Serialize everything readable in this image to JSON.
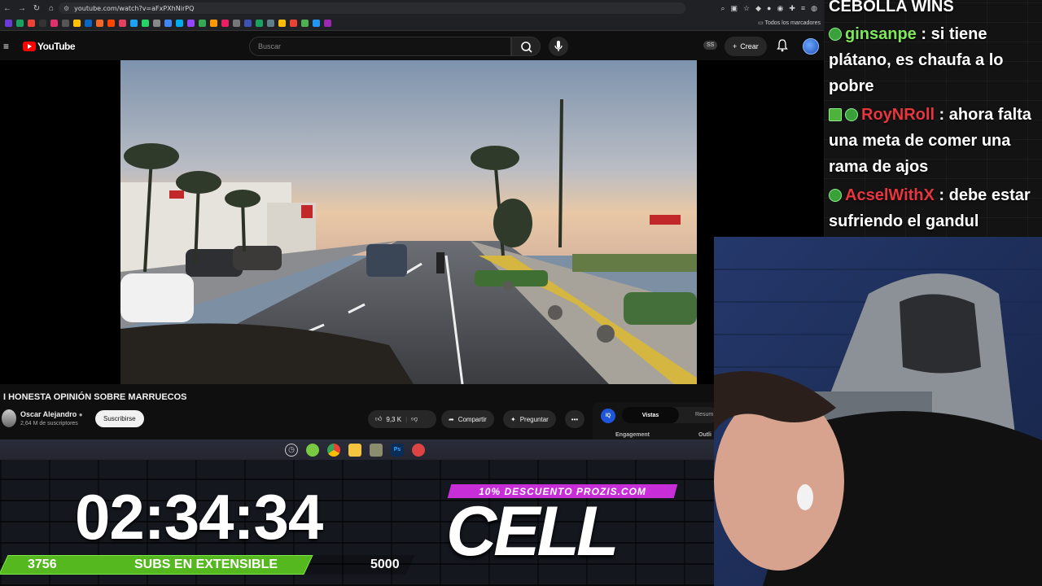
{
  "browser": {
    "url": "youtube.com/watch?v=aFxPXhNirPQ",
    "bookmarks_folder_label": "Todos los marcadores"
  },
  "youtube": {
    "logo_text": "YouTube",
    "search_placeholder": "Buscar",
    "header_badge": "SS",
    "create_label": "Crear",
    "video_title": "I HONESTA OPINIÓN SOBRE MARRUECOS",
    "channel_name": "Oscar Alejandro",
    "channel_subscribers": "2,64 M de suscriptores",
    "subscribe_label": "Suscribirse",
    "likes": "9,3 K",
    "share_label": "Compartir",
    "ask_label": "Preguntar",
    "side_panel": {
      "iq_label": "IQ",
      "tab_active": "Vistas",
      "tab_2": "Resum",
      "metric_1": "Engagement",
      "metric_2": "Outli"
    }
  },
  "stream_overlay": {
    "timer": "02:34:34",
    "subgoal_current": "3756",
    "subgoal_label": "SUBS EN EXTENSIBLE",
    "subgoal_target": "5000",
    "subgoal_progress": 0.75,
    "promo_text": "10% DESCUENTO PROZIS.COM",
    "brand_logo": "CELL"
  },
  "chat": {
    "messages": [
      {
        "user": "",
        "text": "CEBOLLA WINS"
      },
      {
        "user": "ginsanpe",
        "text": "si tiene plátano, es chaufa a lo pobre"
      },
      {
        "user": "RoyNRoll",
        "text": "ahora falta una meta de comer una rama de ajos"
      },
      {
        "user": "AcselWithX",
        "text": "debe estar sufriendo el gandul"
      }
    ]
  },
  "colors": {
    "yt_red": "#ff0000",
    "goal_green": "#54b81e",
    "promo_magenta": "#c82ed8",
    "chat_user_green": "#7ee85a",
    "chat_user_red": "#e8363e"
  }
}
